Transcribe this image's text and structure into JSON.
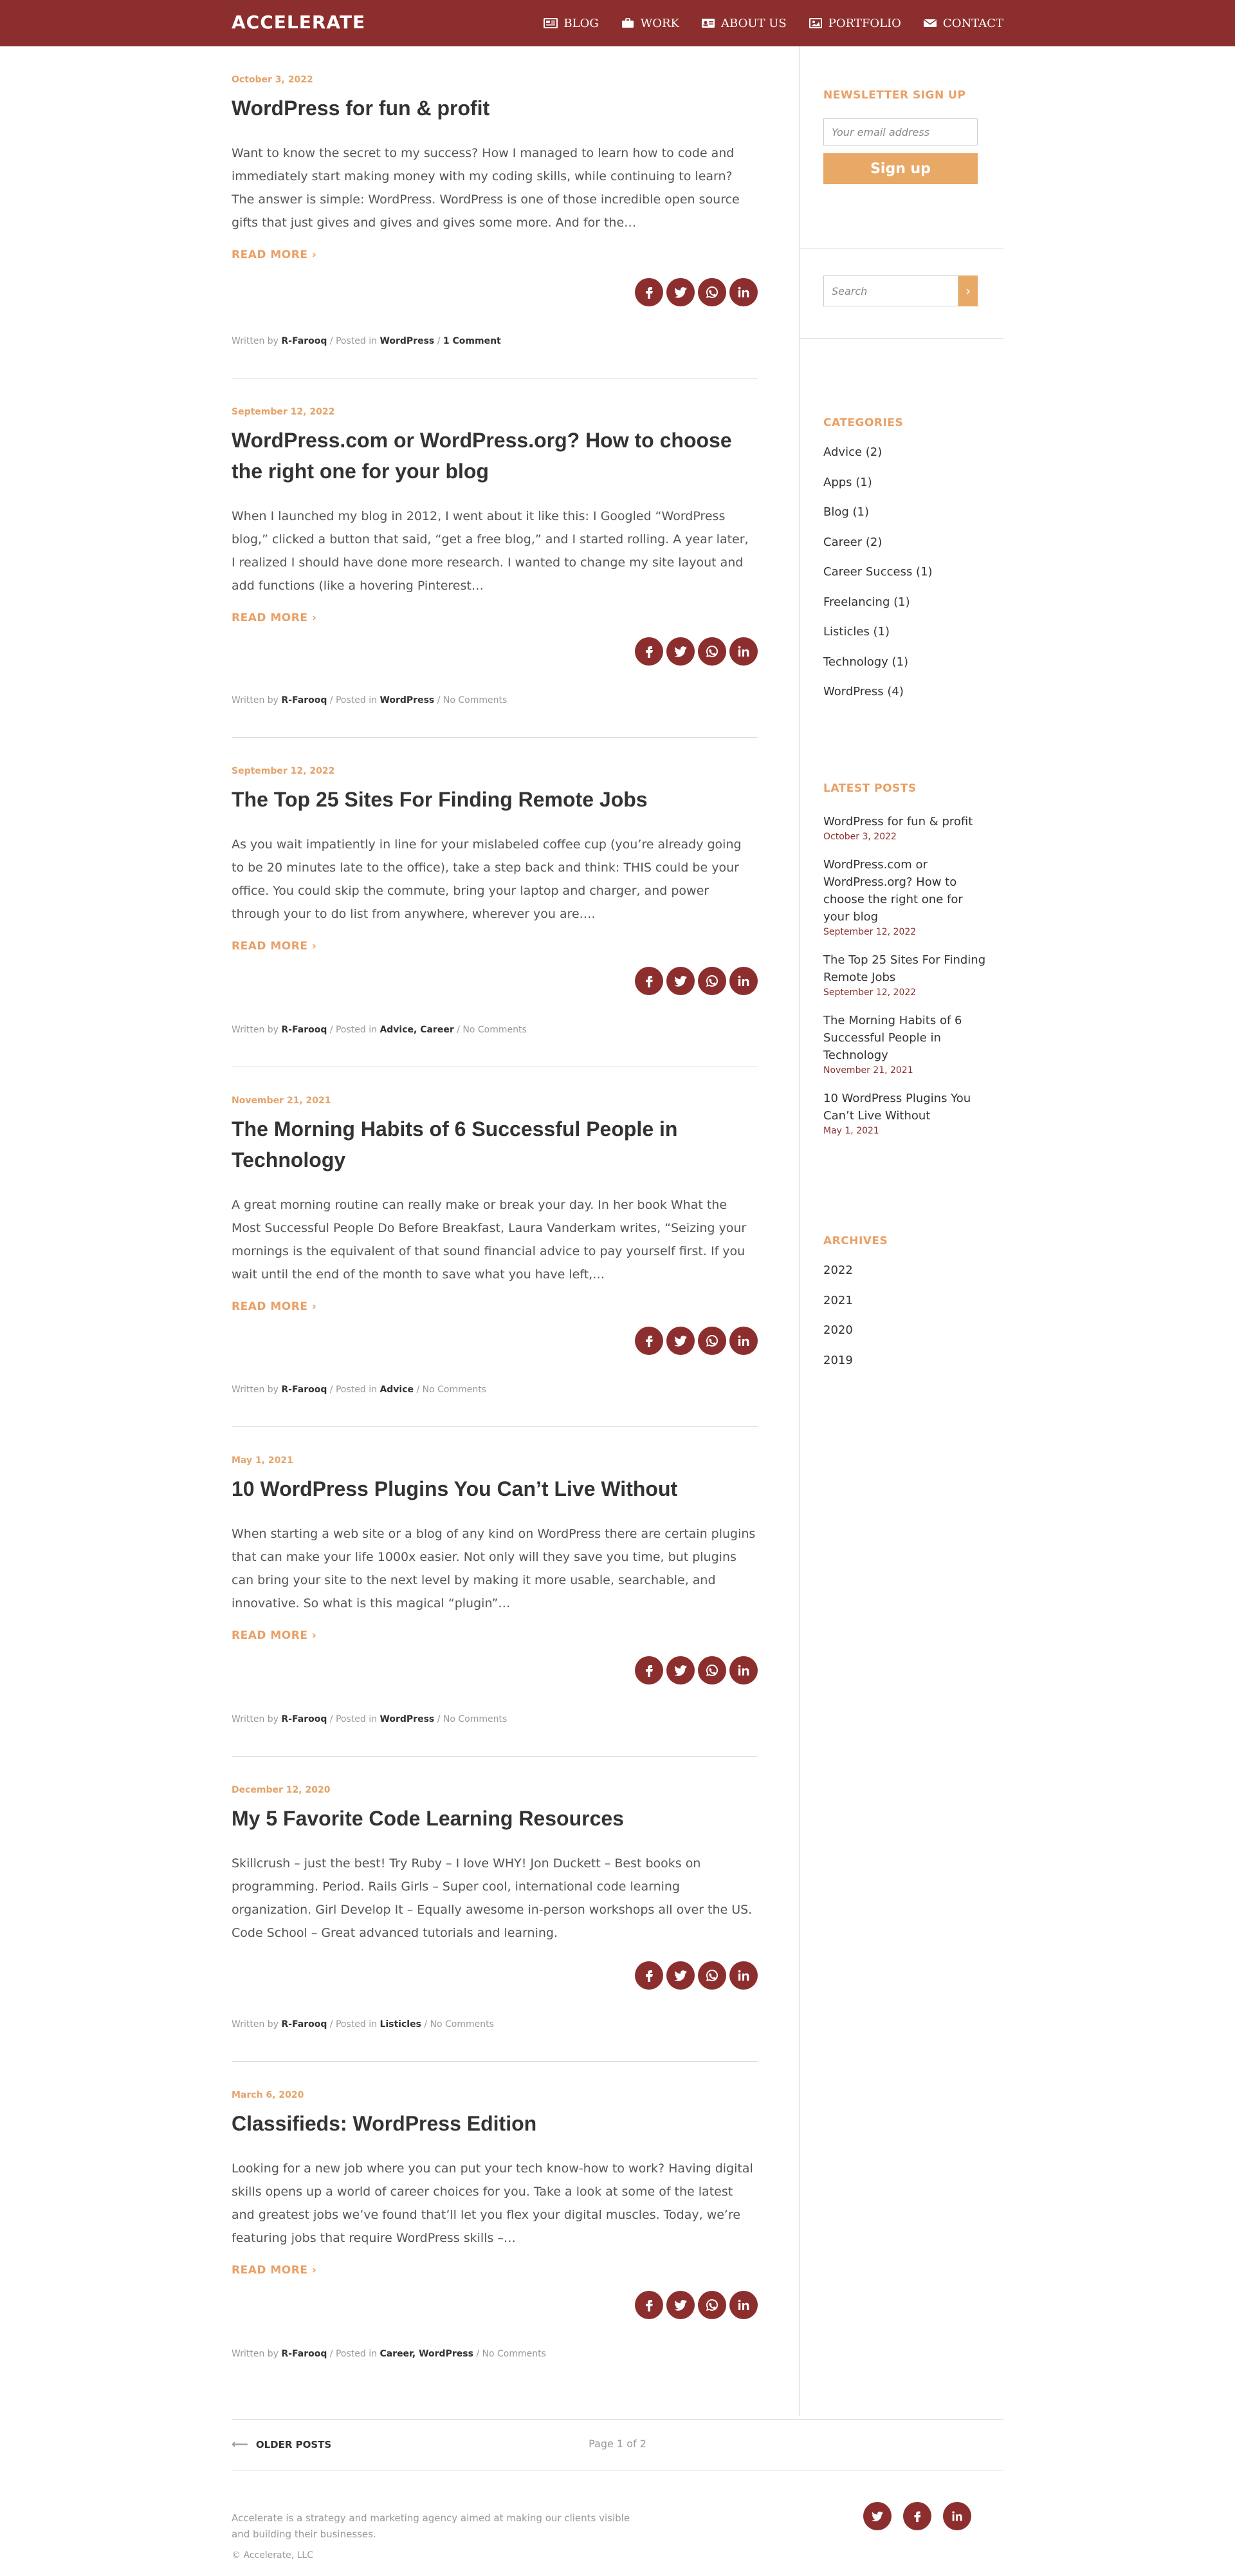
{
  "header": {
    "logo": "ACCELERATE",
    "nav": [
      {
        "label": "BLOG",
        "icon": "newspaper-icon"
      },
      {
        "label": "WORK",
        "icon": "briefcase-icon"
      },
      {
        "label": "ABOUT US",
        "icon": "id-card-icon"
      },
      {
        "label": "PORTFOLIO",
        "icon": "picture-icon"
      },
      {
        "label": "CONTACT",
        "icon": "envelope-icon"
      }
    ]
  },
  "posts": [
    {
      "date": "October 3, 2022",
      "title": "WordPress for fun & profit",
      "excerpt": "Want to know the secret to my success? How I managed to learn how to code and immediately start making money with my coding skills, while continuing to learn? The answer is simple: WordPress. WordPress is one of those incredible open source gifts that just gives and gives and gives some more. And for the…",
      "read_more": "READ MORE ›",
      "meta_written": "Written by",
      "author": "R-Farooq",
      "meta_posted": " / Posted in ",
      "categories": "WordPress",
      "comments": "1 Comment"
    },
    {
      "date": "September 12, 2022",
      "title": "WordPress.com or WordPress.org? How to choose the right one for your blog",
      "excerpt": "When I launched my blog in 2012, I went about it like this: I Googled “WordPress blog,” clicked a button that said, “get a free blog,” and I started rolling. A year later, I realized I should have done more research. I wanted to change my site layout and add functions (like a hovering Pinterest…",
      "read_more": "READ MORE ›",
      "meta_written": "Written by",
      "author": "R-Farooq",
      "meta_posted": " / Posted in ",
      "categories": "WordPress",
      "comments": "No Comments"
    },
    {
      "date": "September 12, 2022",
      "title": "The Top 25 Sites For Finding Remote Jobs",
      "excerpt": "As you wait impatiently in line for your mislabeled coffee cup (you’re already going to be 20 minutes late to the office), take a step back and think: THIS could be your office. You could skip the commute, bring your laptop and charger, and power through your to do list from anywhere, wherever you are.…",
      "read_more": "READ MORE ›",
      "meta_written": "Written by",
      "author": "R-Farooq",
      "meta_posted": " / Posted in ",
      "categories": "Advice, Career",
      "comments": "No Comments"
    },
    {
      "date": "November 21, 2021",
      "title": "The Morning Habits of 6 Successful People in Technology",
      "excerpt": "A great morning routine can really make or break your day. In her book What the Most Successful People Do Before Breakfast, Laura Vanderkam writes, “Seizing your mornings is the equivalent of that sound financial advice to pay yourself first. If you wait until the end of the month to save what you have left,…",
      "read_more": "READ MORE ›",
      "meta_written": "Written by",
      "author": "R-Farooq",
      "meta_posted": " / Posted in ",
      "categories": "Advice",
      "comments": "No Comments"
    },
    {
      "date": "May 1, 2021",
      "title": "10 WordPress Plugins You Can’t Live Without",
      "excerpt": "When starting a web site or a blog of any kind on WordPress there are certain plugins that can make your life 1000x easier. Not only will they save you time, but plugins can bring your site to the next level by making it more usable, searchable, and innovative. So what is this magical “plugin”…",
      "read_more": "READ MORE ›",
      "meta_written": "Written by",
      "author": "R-Farooq",
      "meta_posted": " / Posted in ",
      "categories": "WordPress",
      "comments": "No Comments"
    },
    {
      "date": "December 12, 2020",
      "title": "My 5 Favorite Code Learning Resources",
      "excerpt": "Skillcrush – just the best! Try Ruby – I love WHY! Jon Duckett – Best books on programming. Period. Rails Girls – Super cool, international code learning organization. Girl Develop It – Equally awesome in-person workshops all over the US. Code School – Great advanced tutorials and learning.",
      "read_more": "",
      "meta_written": "Written by",
      "author": "R-Farooq",
      "meta_posted": " / Posted in ",
      "categories": "Listicles",
      "comments": "No Comments"
    },
    {
      "date": "March 6, 2020",
      "title": "Classifieds: WordPress Edition",
      "excerpt": "Looking for a new job where you can put your tech know-how to work? Having digital skills opens up a world of career choices for you. Take a look at some of the latest and greatest jobs we’ve found that’ll let you flex your digital muscles. Today, we’re featuring jobs that require WordPress skills –…",
      "read_more": "READ MORE ›",
      "meta_written": "Written by",
      "author": "R-Farooq",
      "meta_posted": " / Posted in ",
      "categories": "Career, WordPress",
      "comments": "No Comments"
    }
  ],
  "sidebar": {
    "newsletter": {
      "heading": "NEWSLETTER SIGN UP",
      "placeholder": "Your email address",
      "button": "Sign up"
    },
    "search": {
      "placeholder": "Search",
      "icon": "chevron-right-icon"
    },
    "categories": {
      "heading": "CATEGORIES",
      "items": [
        "Advice (2)",
        "Apps (1)",
        "Blog (1)",
        "Career (2)",
        "Career Success (1)",
        "Freelancing (1)",
        "Listicles (1)",
        "Technology (1)",
        "WordPress (4)"
      ]
    },
    "latest": {
      "heading": "LATEST POSTS",
      "items": [
        {
          "title": "WordPress for fun & profit",
          "date": "October 3, 2022"
        },
        {
          "title": "WordPress.com or WordPress.org? How to choose the right one for your blog",
          "date": "September 12, 2022"
        },
        {
          "title": "The Top 25 Sites For Finding Remote Jobs",
          "date": "September 12, 2022"
        },
        {
          "title": "The Morning Habits of 6 Successful People in Technology",
          "date": "November 21, 2021"
        },
        {
          "title": "10 WordPress Plugins You Can’t Live Without",
          "date": "May 1, 2021"
        }
      ]
    },
    "archives": {
      "heading": "ARCHIVES",
      "items": [
        "2022",
        "2021",
        "2020",
        "2019"
      ]
    }
  },
  "pagination": {
    "older": "OLDER POSTS",
    "arrow": "⟵",
    "page_info": "Page 1 of 2"
  },
  "footer": {
    "text": "Accelerate is a strategy and marketing agency aimed at making our clients visible and building their businesses.",
    "copyright": "© Accelerate, LLC"
  },
  "share_icons": [
    "facebook-icon",
    "twitter-icon",
    "whatsapp-icon",
    "linkedin-icon"
  ],
  "footer_social_icons": [
    "twitter-icon",
    "facebook-icon",
    "linkedin-icon"
  ],
  "colors": {
    "brand": "#8c2e2e",
    "accent": "#e9a066",
    "date": "#e4a36a"
  }
}
